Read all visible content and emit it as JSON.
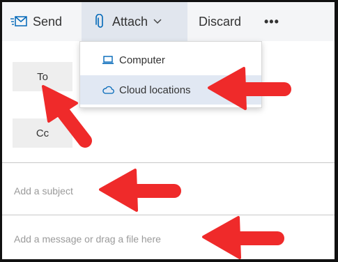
{
  "toolbar": {
    "send_label": "Send",
    "attach_label": "Attach",
    "discard_label": "Discard",
    "more_label": "•••"
  },
  "attach_menu": {
    "items": [
      {
        "label": "Computer",
        "icon": "laptop-icon"
      },
      {
        "label": "Cloud locations",
        "icon": "cloud-icon",
        "highlighted": true
      }
    ]
  },
  "recipients": {
    "to_label": "To",
    "cc_label": "Cc"
  },
  "compose": {
    "subject_placeholder": "Add a subject",
    "body_placeholder": "Add a message or drag a file here"
  },
  "colors": {
    "accent": "#0067b8",
    "annotation_arrow": "#ef2a2a",
    "menu_highlight": "#e1e8f3"
  }
}
